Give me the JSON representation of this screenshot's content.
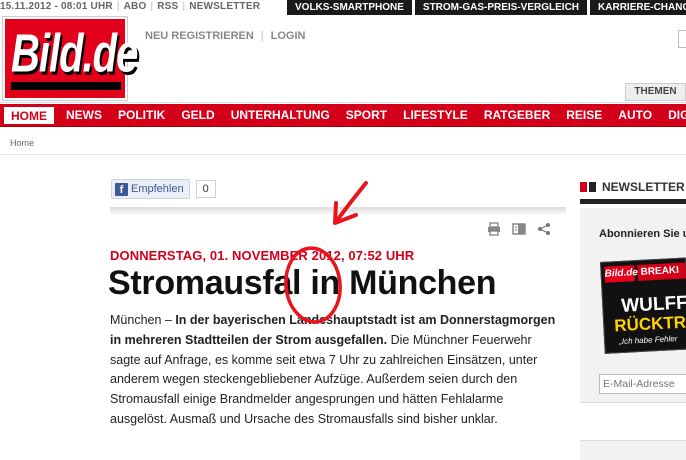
{
  "topbar": {
    "date": "15.11.2012 - 08:01 UHR",
    "abo": "ABO",
    "rss": "RSS",
    "newsletter": "NEWSLETTER",
    "links": [
      "VOLKS-SMARTPHONE",
      "STROM-GAS-PREIS-VERGLEICH",
      "KARRIERE-CHANCEN"
    ]
  },
  "header": {
    "logo_text": "Bild.de",
    "register": "NEU REGISTRIEREN",
    "login": "LOGIN",
    "themen": "THEMEN"
  },
  "nav": {
    "items": [
      "HOME",
      "NEWS",
      "POLITIK",
      "GELD",
      "UNTERHALTUNG",
      "SPORT",
      "LIFESTYLE",
      "RATGEBER",
      "REISE",
      "AUTO",
      "DIGITAL"
    ],
    "active": "HOME"
  },
  "breadcrumb": "Home",
  "social": {
    "like_label": "Empfehlen",
    "like_count": "0"
  },
  "article": {
    "dateline": "DONNERSTAG, 01. NOVEMBER 2012, 07:52 UHR",
    "headline": "Stromausfal in München",
    "location": "München – ",
    "lead": "In der bayerischen Landeshauptstadt ist am Donnerstagmorgen in mehreren Stadtteilen der Strom ausgefallen.",
    "body": " Die Münchner Feuerwehr sagte auf Anfrage, es komme seit etwa 7 Uhr zu zahlreichen Einsätzen, unter anderem wegen steckengebliebener Aufzüge. Außerdem seien durch den Stromausfall einige Brandmelder angesprungen und hätten Fehlalarme ausgelöst. Ausmaß und Ursache des Stromausfalls sind bisher unklar."
  },
  "sidebar": {
    "title": "NEWSLETTER",
    "subscribe": "Abonnieren Sie u",
    "promo": {
      "logo": "Bild.de",
      "badge": "BREAKI",
      "line1": "WULFF",
      "line2": "RÜCKTRIT",
      "line3": "„Ich habe Fehler"
    },
    "email_placeholder": "E-Mail-Adresse"
  },
  "colors": {
    "brand_red": "#d4001a",
    "annotation_red": "#e8141e"
  }
}
